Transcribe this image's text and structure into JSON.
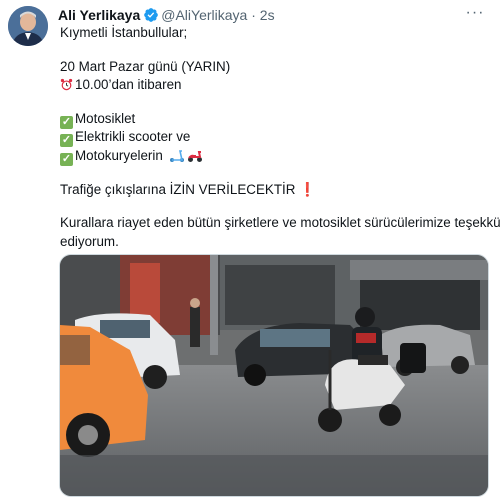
{
  "tweet": {
    "author_name": "Ali Yerlikaya",
    "handle": "@AliYerlikaya",
    "separator": "·",
    "time": "2s",
    "more_label": "···",
    "lines": {
      "l1": "Kıymetli İstanbullular;",
      "l2": "20 Mart Pazar günü (YARIN)",
      "l3": "10.00’dan itibaren",
      "l4": "Motosiklet",
      "l5": "Elektrikli scooter ve",
      "l6": "Motokuryelerin",
      "l7a": "Trafiğe çıkışlarına İZİN VERİLECEKTİR",
      "l7b": "❗",
      "l8": "Kurallara riayet eden bütün şirketlere ve motosiklet sürücülerimize teşekkür",
      "l9": "ediyorum."
    },
    "check_mark": "✓"
  },
  "colors": {
    "verified": "#1d9bf0",
    "check_emoji": "#77b255",
    "secondary_text": "#536471"
  },
  "icons": [
    "verified-badge-icon",
    "more-icon",
    "alarm-clock-icon",
    "check-box-icon",
    "kick-scooter-icon",
    "motor-scooter-icon"
  ]
}
